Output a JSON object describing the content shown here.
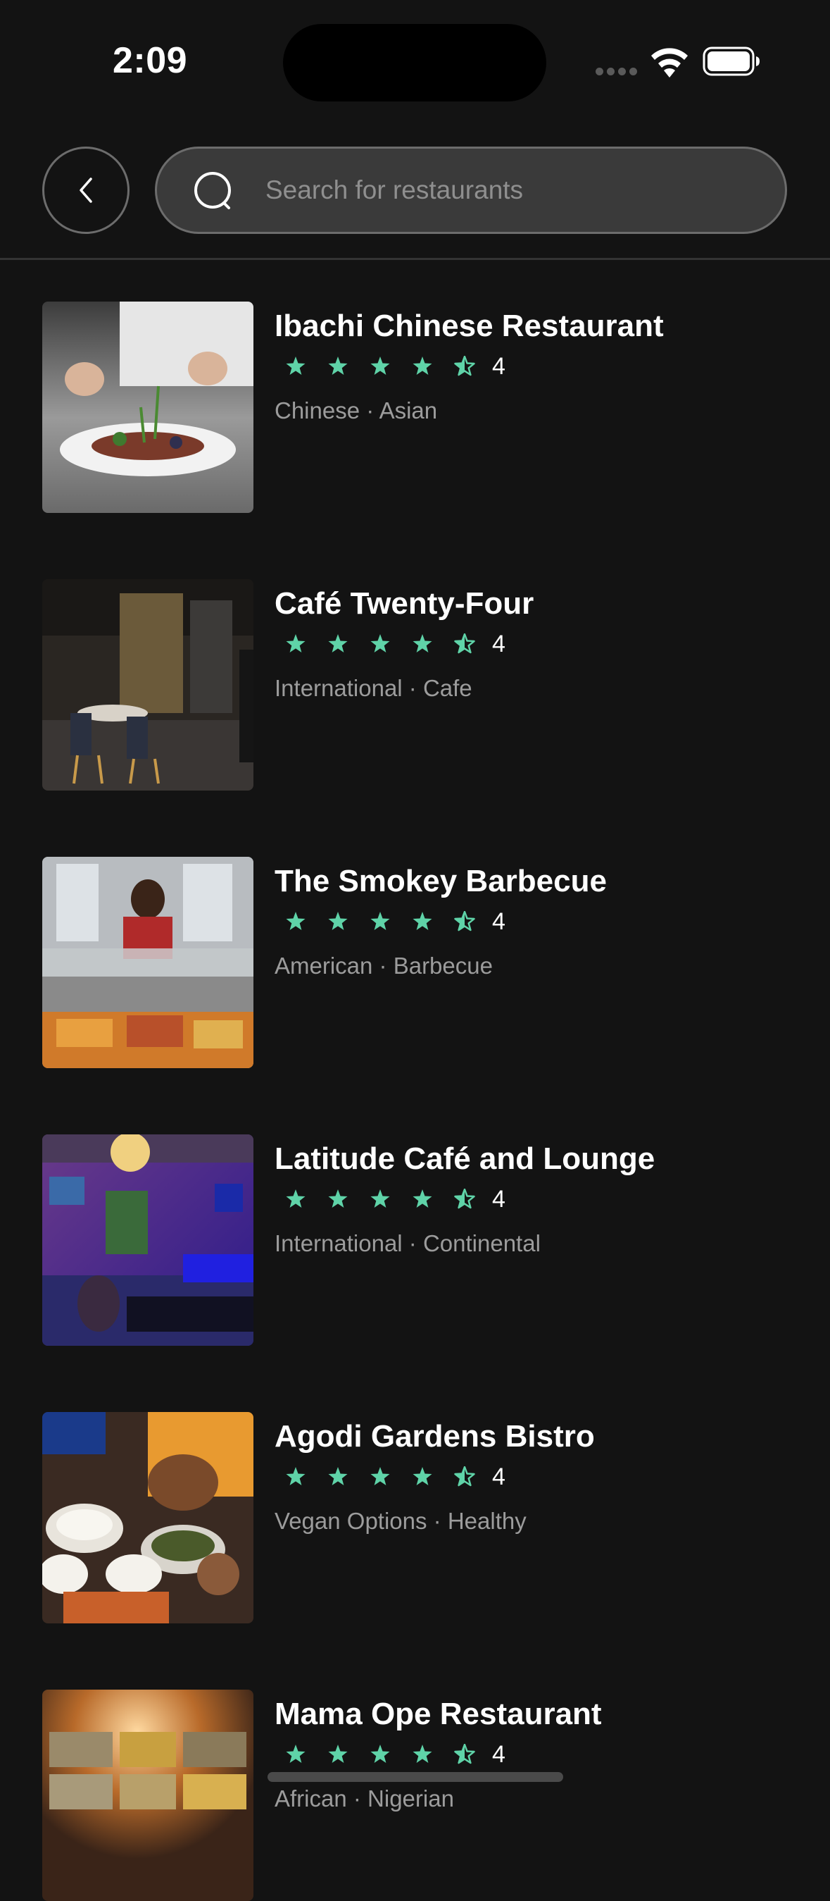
{
  "status_bar": {
    "time": "2:09"
  },
  "search": {
    "placeholder": "Search for restaurants",
    "value": ""
  },
  "colors": {
    "background": "#131313",
    "star": "#5fd3a8",
    "secondary_text": "#9c9c9c",
    "search_bg": "#3a3a3a"
  },
  "restaurants": [
    {
      "name": "Ibachi Chinese Restaurant",
      "rating": "4",
      "stars": 4.5,
      "cuisine": "Chinese · Asian",
      "image": "plated-dish-photo"
    },
    {
      "name": "Café Twenty-Four",
      "rating": "4",
      "stars": 4.5,
      "cuisine": "International · Cafe",
      "image": "dining-room-photo"
    },
    {
      "name": "The Smokey Barbecue",
      "rating": "4",
      "stars": 4.5,
      "cuisine": "American · Barbecue",
      "image": "buffet-counter-photo"
    },
    {
      "name": "Latitude Café and Lounge",
      "rating": "4",
      "stars": 4.5,
      "cuisine": "International · Continental",
      "image": "lounge-interior-photo"
    },
    {
      "name": "Agodi Gardens Bistro",
      "rating": "4",
      "stars": 4.5,
      "cuisine": "Vegan Options · Healthy",
      "image": "shared-meal-photo"
    },
    {
      "name": "Mama Ope Restaurant",
      "rating": "4",
      "stars": 4.5,
      "cuisine": "African · Nigerian",
      "image": "food-trays-photo"
    }
  ]
}
